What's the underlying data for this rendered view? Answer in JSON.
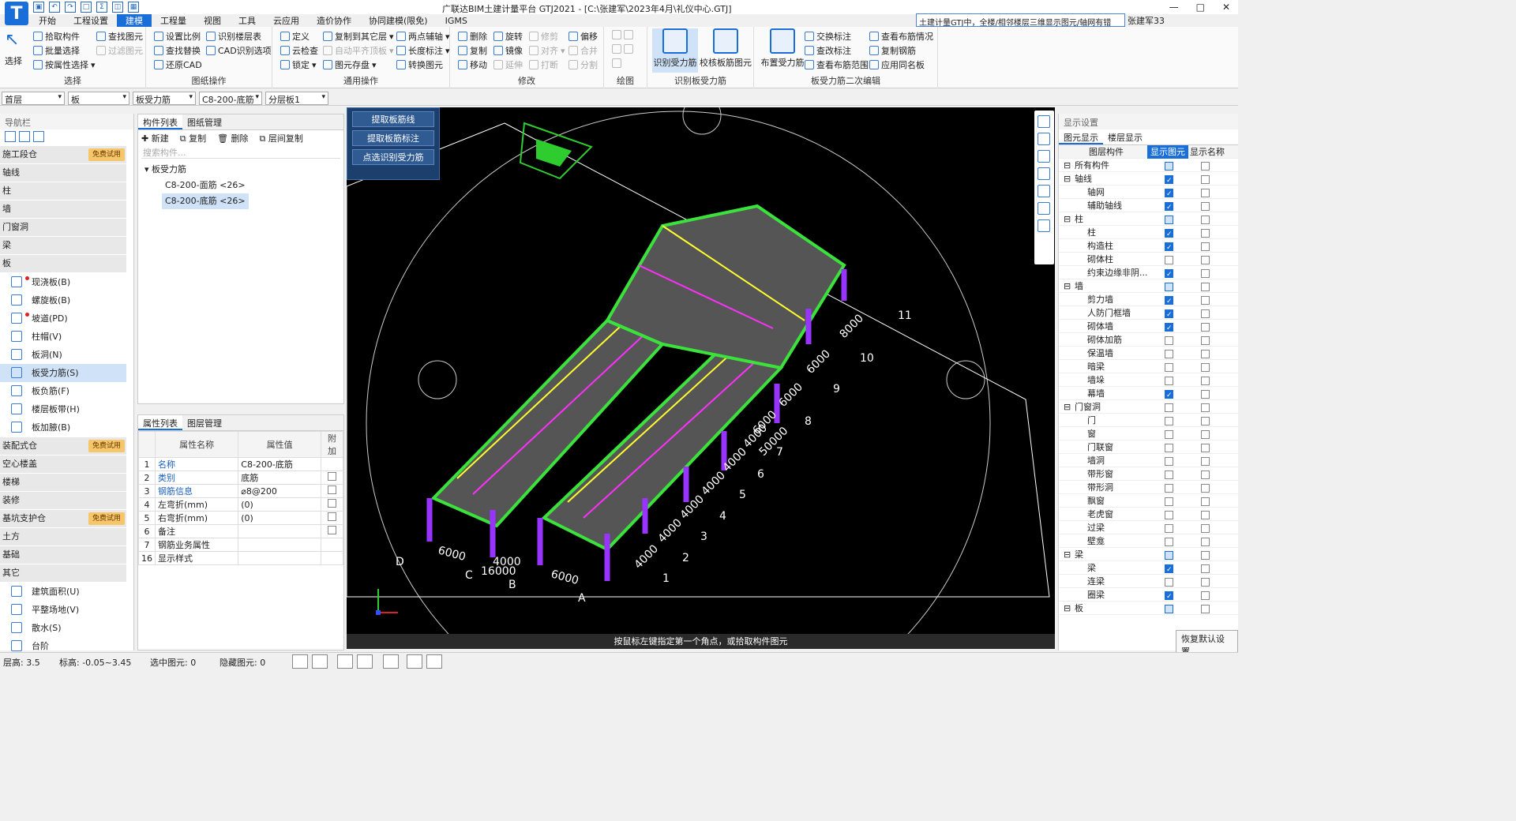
{
  "app": {
    "title": "广联达BIM土建计量平台 GTJ2021 - [C:\\张建军\\2023年4月\\礼仪中心.GTJ]",
    "logo": "T",
    "search": "土建计量GTJ中，全楼/相邻楼层三维显示图元/轴网有错",
    "user": "张建军33"
  },
  "menu": [
    "开始",
    "工程设置",
    "建模",
    "工程量",
    "视图",
    "工具",
    "云应用",
    "造价协作",
    "协同建模(限免)",
    "IGMS"
  ],
  "menu_active": "建模",
  "ribbon": {
    "select": {
      "big": "选择",
      "items": [
        "拾取构件",
        "批量选择",
        "按属性选择"
      ],
      "items2": [
        "查找图元",
        "过滤图元"
      ],
      "label": "选择"
    },
    "drawing": {
      "items": [
        "设置比例",
        "识别楼层表",
        "查找替换",
        "CAD识别选项",
        "还原CAD"
      ],
      "label": "图纸操作"
    },
    "common": {
      "items": [
        "定义",
        "复制到其它层",
        "两点辅轴",
        "云检查",
        "自动平齐顶板",
        "长度标注",
        "锁定",
        "图元存盘",
        "转换图元"
      ],
      "label": "通用操作"
    },
    "modify": {
      "items": [
        "删除",
        "旋转",
        "修剪",
        "偏移",
        "复制",
        "镜像",
        "对齐",
        "合并",
        "移动",
        "延伸",
        "打断",
        "分割"
      ],
      "label": "修改"
    },
    "draw": {
      "label": "绘图"
    },
    "identify": {
      "b1": "识别受力筋",
      "b2": "校核板筋图元",
      "label": "识别板受力筋"
    },
    "edit2": {
      "b1": "布置受力筋",
      "items": [
        "交换标注",
        "查看布筋情况",
        "查改标注",
        "复制钢筋",
        "查看布筋范围",
        "应用同名板"
      ],
      "label": "板受力筋二次编辑"
    }
  },
  "combos": [
    "首层",
    "板",
    "板受力筋",
    "C8-200-底筋",
    "分层板1"
  ],
  "nav": {
    "title": "导航栏",
    "cats": [
      {
        "name": "施工段仓",
        "badge": "免费试用"
      },
      {
        "name": "轴线"
      },
      {
        "name": "柱"
      },
      {
        "name": "墙"
      },
      {
        "name": "门窗洞"
      },
      {
        "name": "梁"
      },
      {
        "name": "板"
      }
    ],
    "items": [
      {
        "name": "现浇板(B)",
        "dot": true
      },
      {
        "name": "螺旋板(B)"
      },
      {
        "name": "坡道(PD)",
        "dot": true
      },
      {
        "name": "柱帽(V)"
      },
      {
        "name": "板洞(N)"
      },
      {
        "name": "板受力筋(S)",
        "sel": true
      },
      {
        "name": "板负筋(F)"
      },
      {
        "name": "楼层板带(H)"
      },
      {
        "name": "板加腋(B)"
      }
    ],
    "cats2": [
      {
        "name": "装配式仓",
        "badge": "免费试用"
      },
      {
        "name": "空心楼盖"
      },
      {
        "name": "楼梯"
      },
      {
        "name": "装修"
      },
      {
        "name": "基坑支护仓",
        "badge": "免费试用"
      },
      {
        "name": "土方"
      },
      {
        "name": "基础"
      },
      {
        "name": "其它"
      }
    ],
    "items2": [
      {
        "name": "建筑面积(U)"
      },
      {
        "name": "平整场地(V)"
      },
      {
        "name": "散水(S)"
      },
      {
        "name": "台阶"
      }
    ]
  },
  "complist": {
    "tabs": [
      "构件列表",
      "图纸管理"
    ],
    "tools": [
      "新建",
      "复制",
      "删除",
      "层间复制"
    ],
    "search": "搜索构件...",
    "root": "板受力筋",
    "items": [
      "C8-200-面筋 <26>",
      "C8-200-底筋 <26>"
    ]
  },
  "props": {
    "tabs": [
      "属性列表",
      "图层管理"
    ],
    "headers": [
      "属性名称",
      "属性值",
      "附加"
    ],
    "rows": [
      [
        "1",
        "名称",
        "C8-200-底筋"
      ],
      [
        "2",
        "类别",
        "底筋"
      ],
      [
        "3",
        "钢筋信息",
        "⌀8@200"
      ],
      [
        "4",
        "左弯折(mm)",
        "(0)"
      ],
      [
        "5",
        "右弯折(mm)",
        "(0)"
      ],
      [
        "6",
        "备注",
        ""
      ],
      [
        "7",
        "钢筋业务属性",
        ""
      ],
      [
        "16",
        "显示样式",
        ""
      ]
    ]
  },
  "float": [
    "提取板筋线",
    "提取板筋标注",
    "点选识别受力筋"
  ],
  "vstatus": "按鼠标左键指定第一个角点，或拾取构件图元",
  "dims": {
    "bottom": [
      "6000",
      "4000",
      "16000",
      "6000"
    ],
    "axes_letters": [
      "D",
      "C",
      "B",
      "A"
    ],
    "right": [
      "4000",
      "4000",
      "4000",
      "4000",
      "4000",
      "4000",
      "6000",
      "50000",
      "6000",
      "6000",
      "8000"
    ],
    "nums": [
      "1",
      "2",
      "3",
      "4",
      "5",
      "6",
      "7",
      "8",
      "9",
      "10",
      "11"
    ]
  },
  "display": {
    "title": "显示设置",
    "tabs": [
      "图元显示",
      "楼层显示"
    ],
    "headers": [
      "图层构件",
      "显示图元",
      "显示名称"
    ],
    "rows": [
      [
        "所有构件",
        0,
        "p",
        0
      ],
      [
        "轴线",
        1,
        "on",
        0
      ],
      [
        "轴网",
        2,
        "on",
        0
      ],
      [
        "辅助轴线",
        2,
        "on",
        0
      ],
      [
        "柱",
        1,
        "p",
        0
      ],
      [
        "柱",
        2,
        "on",
        0
      ],
      [
        "构造柱",
        2,
        "on",
        0
      ],
      [
        "砌体柱",
        2,
        "",
        0
      ],
      [
        "约束边缘非阴...",
        2,
        "on",
        0
      ],
      [
        "墙",
        1,
        "p",
        0
      ],
      [
        "剪力墙",
        2,
        "on",
        0
      ],
      [
        "人防门框墙",
        2,
        "on",
        0
      ],
      [
        "砌体墙",
        2,
        "on",
        0
      ],
      [
        "砌体加筋",
        2,
        "",
        0
      ],
      [
        "保温墙",
        2,
        "",
        0
      ],
      [
        "暗梁",
        2,
        "",
        0
      ],
      [
        "墙垛",
        2,
        "",
        0
      ],
      [
        "幕墙",
        2,
        "on",
        0
      ],
      [
        "门窗洞",
        1,
        "",
        0
      ],
      [
        "门",
        2,
        "",
        0
      ],
      [
        "窗",
        2,
        "",
        0
      ],
      [
        "门联窗",
        2,
        "",
        0
      ],
      [
        "墙洞",
        2,
        "",
        0
      ],
      [
        "带形窗",
        2,
        "",
        0
      ],
      [
        "带形洞",
        2,
        "",
        0
      ],
      [
        "飘窗",
        2,
        "",
        0
      ],
      [
        "老虎窗",
        2,
        "",
        0
      ],
      [
        "过梁",
        2,
        "",
        0
      ],
      [
        "壁龛",
        2,
        "",
        0
      ],
      [
        "梁",
        1,
        "p",
        0
      ],
      [
        "梁",
        2,
        "on",
        0
      ],
      [
        "连梁",
        2,
        "",
        0
      ],
      [
        "圈梁",
        2,
        "on",
        0
      ],
      [
        "板",
        1,
        "p",
        0
      ]
    ],
    "reset": "恢复默认设置"
  },
  "status": {
    "height": "层高:  3.5",
    "elev": "标高:  -0.05~3.45",
    "selected": "选中图元:  0",
    "hidden": "隐藏图元:  0"
  }
}
